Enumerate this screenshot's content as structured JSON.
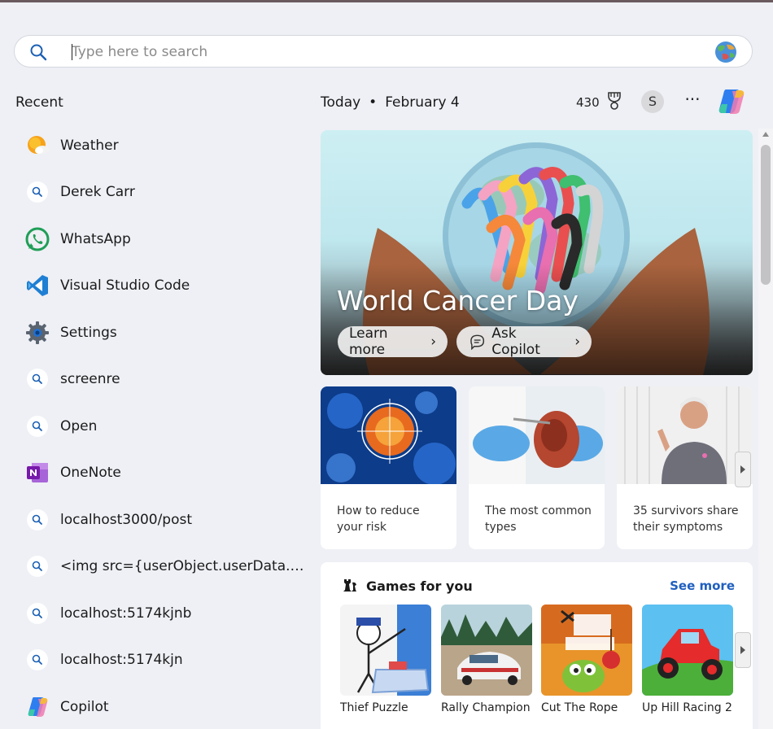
{
  "search": {
    "placeholder": "Type here to search"
  },
  "recent": {
    "title": "Recent",
    "items": [
      {
        "label": "Weather",
        "icon": "weather-icon"
      },
      {
        "label": "Derek Carr",
        "icon": "search-icon"
      },
      {
        "label": "WhatsApp",
        "icon": "whatsapp-icon"
      },
      {
        "label": "Visual Studio Code",
        "icon": "vscode-icon"
      },
      {
        "label": "Settings",
        "icon": "settings-gear-icon"
      },
      {
        "label": "screenre",
        "icon": "search-icon"
      },
      {
        "label": "Open",
        "icon": "search-icon"
      },
      {
        "label": "OneNote",
        "icon": "onenote-icon"
      },
      {
        "label": "localhost3000/post",
        "icon": "search-icon"
      },
      {
        "label": "<img src={userObject.userData.profil...",
        "icon": "search-icon"
      },
      {
        "label": "localhost:5174kjnb",
        "icon": "search-icon"
      },
      {
        "label": "localhost:5174kjn",
        "icon": "search-icon"
      },
      {
        "label": "Copilot",
        "icon": "copilot-icon"
      }
    ]
  },
  "header": {
    "today": "Today",
    "separator": "•",
    "date": "February 4",
    "points": "430",
    "avatar_initial": "S",
    "more": "···"
  },
  "hero": {
    "title": "World Cancer Day",
    "learn_more": "Learn more",
    "ask_copilot": "Ask Copilot",
    "chevron": "›"
  },
  "cards": [
    {
      "caption": "How to reduce your risk"
    },
    {
      "caption": "The most common types"
    },
    {
      "caption": "35 survivors share their symptoms"
    }
  ],
  "games": {
    "title": "Games for you",
    "see_more": "See more",
    "items": [
      {
        "name": "Thief Puzzle"
      },
      {
        "name": "Rally Champion"
      },
      {
        "name": "Cut The Rope"
      },
      {
        "name": "Up Hill Racing 2"
      }
    ]
  },
  "colors": {
    "accent_link": "#1f5fbf",
    "background": "#eef0f5"
  }
}
